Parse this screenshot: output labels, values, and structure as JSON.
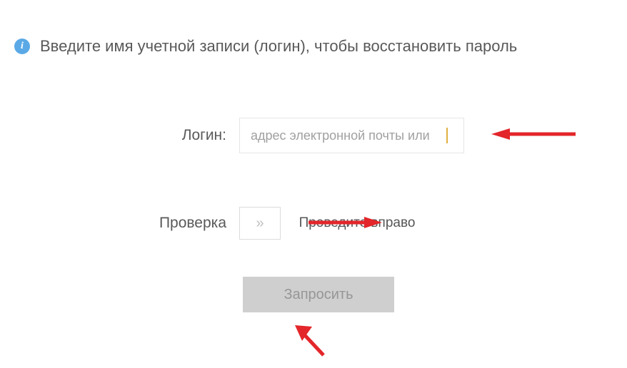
{
  "info": {
    "icon_glyph": "i",
    "text": "Введите имя учетной записи (логин), чтобы восстановить пароль"
  },
  "form": {
    "login": {
      "label": "Логин:",
      "placeholder": "адрес электронной почты или"
    },
    "verify": {
      "label": "Проверка",
      "handle_glyph": "»",
      "hint": "Проведите вправо"
    },
    "submit": {
      "label": "Запросить"
    }
  },
  "colors": {
    "arrow": "#e3262a"
  }
}
